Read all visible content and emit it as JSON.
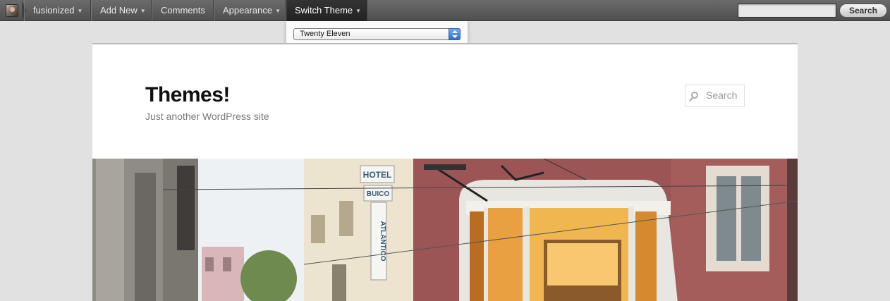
{
  "adminbar": {
    "items": [
      {
        "label": "fusionized",
        "has_caret": true
      },
      {
        "label": "Add New",
        "has_caret": true
      },
      {
        "label": "Comments",
        "has_caret": false
      },
      {
        "label": "Appearance",
        "has_caret": true
      },
      {
        "label": "Switch Theme",
        "has_caret": true
      }
    ],
    "search_button": "Search",
    "search_value": ""
  },
  "dropdown": {
    "selected_theme": "Twenty Eleven"
  },
  "site": {
    "title": "Themes!",
    "description": "Just another WordPress site",
    "search_placeholder": "Search"
  },
  "header_image": {
    "signs": [
      "HOTEL",
      "BUICO",
      "ATLANTICO"
    ]
  },
  "colors": {
    "adminbar": "#555555",
    "page_bg": "#e1e1e1",
    "select_accent": "#2e6fd0"
  }
}
